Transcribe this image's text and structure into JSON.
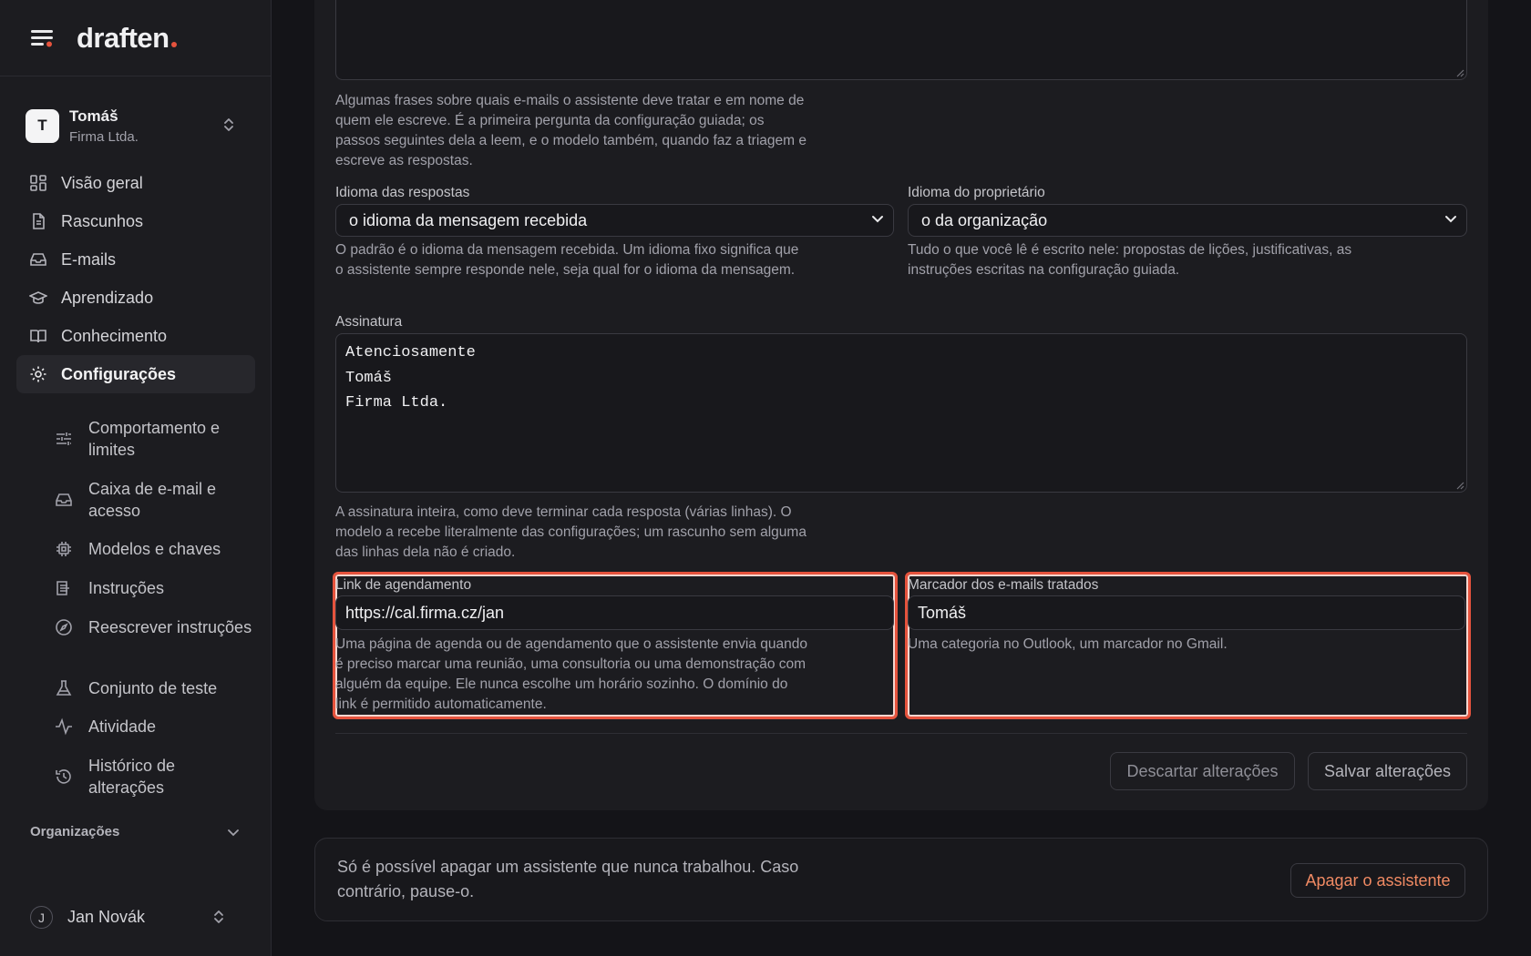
{
  "app": {
    "logo": "draften"
  },
  "account": {
    "initial": "T",
    "name": "Tomáš",
    "org": "Firma Ltda."
  },
  "nav": [
    {
      "label": "Visão geral",
      "icon": "dashboard-icon"
    },
    {
      "label": "Rascunhos",
      "icon": "document-icon"
    },
    {
      "label": "E-mails",
      "icon": "inbox-icon"
    },
    {
      "label": "Aprendizado",
      "icon": "graduation-cap-icon"
    },
    {
      "label": "Conhecimento",
      "icon": "book-icon"
    },
    {
      "label": "Configurações",
      "icon": "gear-icon",
      "active": true
    }
  ],
  "subnav": [
    {
      "label": "Comportamento e limites",
      "icon": "sliders-icon"
    },
    {
      "label": "Caixa de e-mail e acesso",
      "icon": "inbox-icon"
    },
    {
      "label": "Modelos e chaves",
      "icon": "chip-icon"
    },
    {
      "label": "Instruções",
      "icon": "instructions-icon"
    },
    {
      "label": "Reescrever instruções",
      "icon": "compass-icon"
    },
    {
      "label": "Conjunto de teste",
      "icon": "flask-icon"
    },
    {
      "label": "Atividade",
      "icon": "activity-icon"
    },
    {
      "label": "Histórico de alterações",
      "icon": "history-icon"
    }
  ],
  "orgs_label": "Organizações",
  "user": {
    "initial": "J",
    "name": "Jan Novák"
  },
  "form": {
    "intro_help": "Algumas frases sobre quais e-mails o assistente deve tratar e em nome de quem ele escreve. É a primeira pergunta da configuração guiada; os passos seguintes dela a leem, e o modelo também, quando faz a triagem e escreve as respostas.",
    "reply_lang": {
      "label": "Idioma das respostas",
      "value": "o idioma da mensagem recebida",
      "help": "O padrão é o idioma da mensagem recebida. Um idioma fixo significa que o assistente sempre responde nele, seja qual for o idioma da mensagem."
    },
    "owner_lang": {
      "label": "Idioma do proprietário",
      "value": "o da organização",
      "help": "Tudo o que você lê é escrito nele: propostas de lições, justificativas, as instruções escritas na configuração guiada."
    },
    "signature": {
      "label": "Assinatura",
      "lines": [
        "Atenciosamente",
        "Tomáš",
        "Firma Ltda."
      ],
      "help": "A assinatura inteira, como deve terminar cada resposta (várias linhas). O modelo a recebe literalmente das configurações; um rascunho sem alguma das linhas dela não é criado."
    },
    "scheduling": {
      "label": "Link de agendamento",
      "value": "https://cal.firma.cz/jan",
      "help": "Uma página de agenda ou de agendamento que o assistente envia quando é preciso marcar uma reunião, uma consultoria ou uma demonstração com alguém da equipe. Ele nunca escolhe um horário sozinho. O domínio do link é permitido automaticamente."
    },
    "marker": {
      "label": "Marcador dos e-mails tratados",
      "value": "Tomáš",
      "help": "Uma categoria no Outlook, um marcador no Gmail."
    },
    "discard_label": "Descartar alterações",
    "save_label": "Salvar alterações"
  },
  "danger": {
    "text": "Só é possível apagar um assistente que nunca trabalhou. Caso contrário, pause-o.",
    "button": "Apagar o assistente"
  },
  "colors": {
    "accent": "#e5533d",
    "danger_text": "#f08a63"
  }
}
